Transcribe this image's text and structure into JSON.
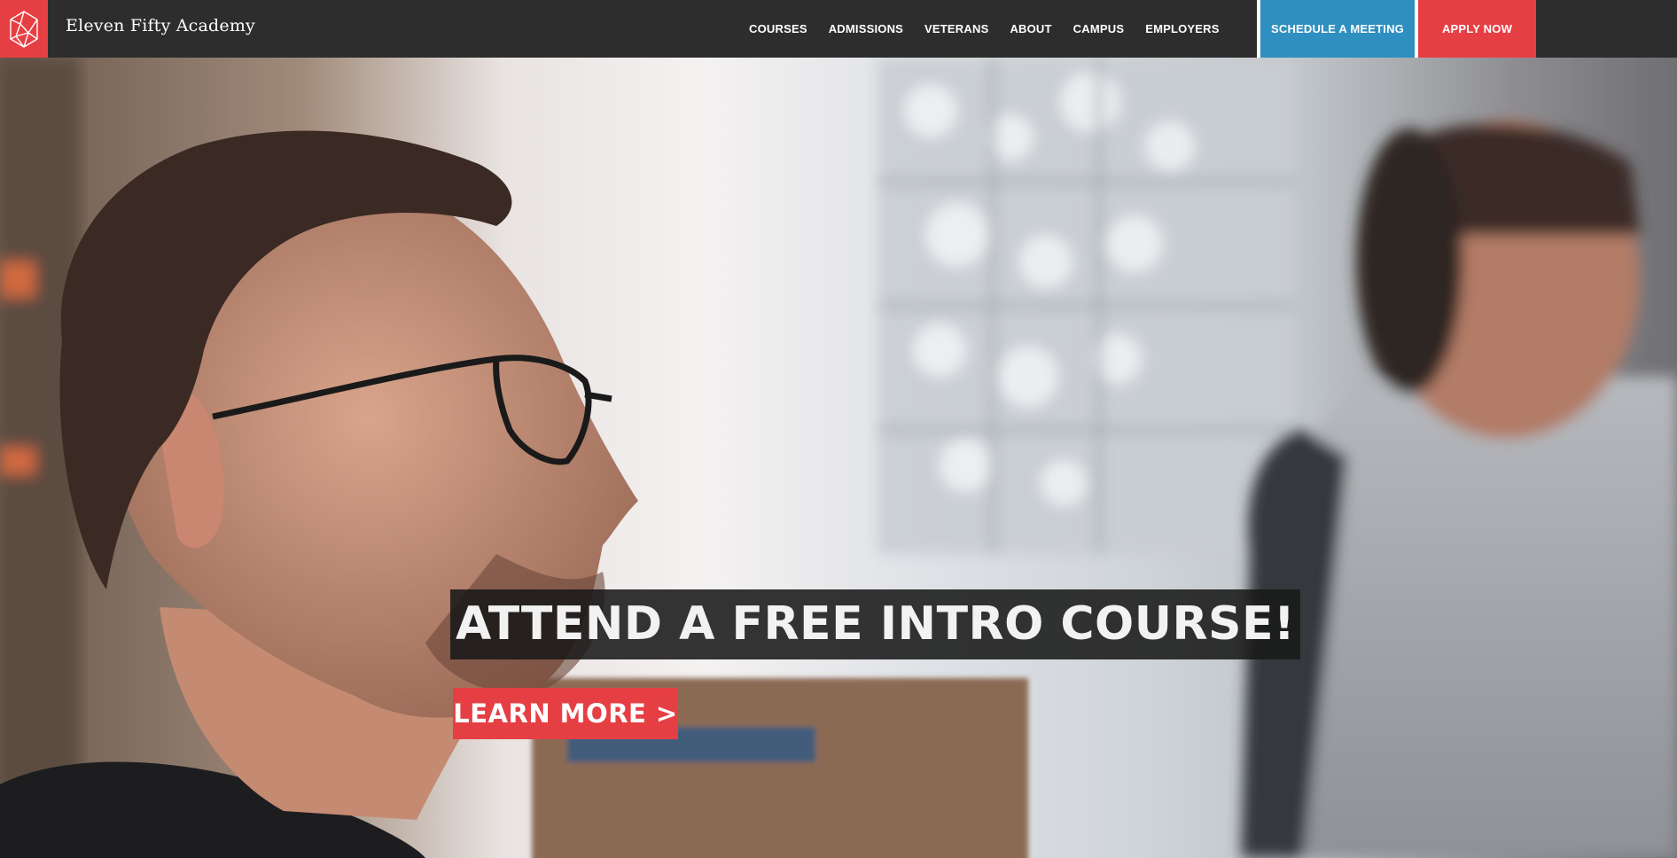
{
  "brand": {
    "name": "Eleven Fifty Academy",
    "logo_icon": "polyhedron-logo-icon"
  },
  "nav": {
    "items": [
      {
        "label": "COURSES"
      },
      {
        "label": "ADMISSIONS"
      },
      {
        "label": "VETERANS"
      },
      {
        "label": "ABOUT"
      },
      {
        "label": "CAMPUS"
      },
      {
        "label": "EMPLOYERS"
      }
    ],
    "schedule_label": "SCHEDULE A MEETING",
    "apply_label": "APPLY NOW"
  },
  "hero": {
    "headline": "ATTEND A FREE INTRO COURSE!",
    "cta_label": "LEARN MORE >"
  },
  "colors": {
    "nav_bg": "#2d2d2d",
    "brand_red": "#e63f43",
    "meeting_blue": "#2f8fc0"
  }
}
